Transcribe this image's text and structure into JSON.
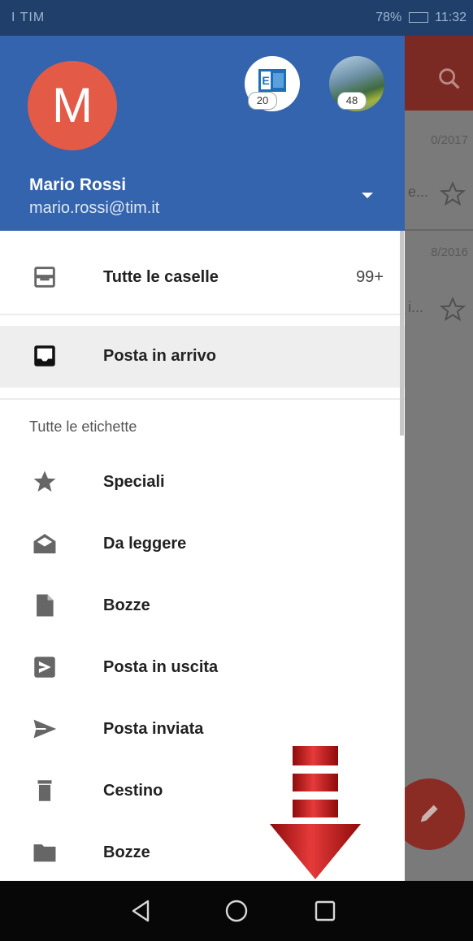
{
  "status_bar": {
    "carrier": "I TIM",
    "battery": "78%",
    "time": "11:32"
  },
  "background_list": {
    "dates": [
      "0/2017",
      "8/2016"
    ],
    "snippets": [
      "e...",
      "i..."
    ]
  },
  "drawer": {
    "avatar_letter": "M",
    "accounts": [
      {
        "name": "exchange-account",
        "count": "20"
      },
      {
        "name": "photo-account",
        "count": "48"
      }
    ],
    "user_name": "Mario Rossi",
    "user_email": "mario.rossi@tim.it",
    "primary_items": [
      {
        "icon": "all-inboxes-icon",
        "label": "Tutte le caselle",
        "count": "99+"
      },
      {
        "icon": "inbox-icon",
        "label": "Posta in arrivo"
      }
    ],
    "section_title": "Tutte le etichette",
    "labels": [
      {
        "icon": "star-icon",
        "label": "Speciali"
      },
      {
        "icon": "unread-mail-icon",
        "label": "Da leggere"
      },
      {
        "icon": "draft-icon",
        "label": "Bozze"
      },
      {
        "icon": "outbox-icon",
        "label": "Posta in uscita"
      },
      {
        "icon": "send-icon",
        "label": "Posta inviata"
      },
      {
        "icon": "trash-icon",
        "label": "Cestino"
      },
      {
        "icon": "folder-icon",
        "label": "Bozze"
      }
    ]
  },
  "colors": {
    "header": "#3464ad",
    "avatar": "#e35b47",
    "arrow": "#d42020"
  }
}
